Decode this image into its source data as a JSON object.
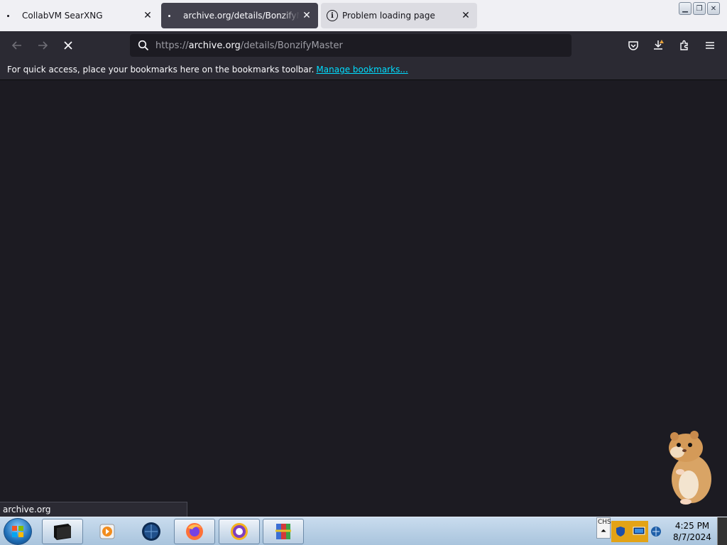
{
  "tabs": [
    {
      "label": "CollabVM SearXNG",
      "icon": "dot-icon",
      "close": "✕"
    },
    {
      "label": "archive.org/details/BonzifyMaster",
      "icon": "dot-icon",
      "close": "✕"
    },
    {
      "label": "Problem loading page",
      "icon": "info-icon",
      "close": "✕"
    }
  ],
  "window_controls": {
    "minimize": "▁",
    "restore": "❐",
    "close": "✕"
  },
  "address_bar": {
    "scheme": "https://",
    "host": "archive.org",
    "path": "/details/BonzifyMaster"
  },
  "bookmarks_bar": {
    "message": "For quick access, place your bookmarks here on the bookmarks toolbar.",
    "link": "Manage bookmarks..."
  },
  "status_text": "archive.org",
  "taskbar": {
    "apps": [
      "terminal-app-icon",
      "media-player-icon",
      "globe-app-icon",
      "firefox-icon",
      "vpn-app-icon",
      "winrar-icon"
    ],
    "language": "CHS"
  },
  "clock": {
    "time": "4:25 PM",
    "date": "8/7/2024"
  },
  "colors": {
    "accent_link": "#00ddff",
    "toolbar": "#2b2a33",
    "content": "#1c1b22"
  }
}
